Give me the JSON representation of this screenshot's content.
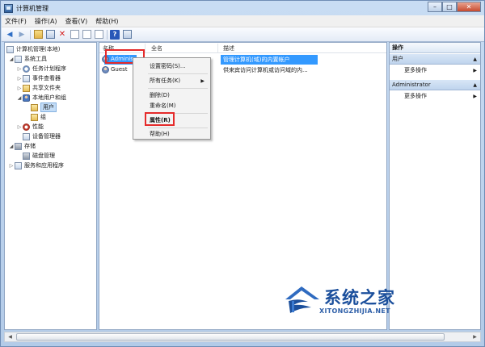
{
  "window": {
    "title": "计算机管理",
    "controls": {
      "minimize": "–",
      "maximize": "□",
      "close": "✕"
    }
  },
  "menu": [
    "文件(F)",
    "操作(A)",
    "查看(V)",
    "帮助(H)"
  ],
  "tree": {
    "root": "计算机管理(本地)",
    "system_tools": "系统工具",
    "task_scheduler": "任务计划程序",
    "event_viewer": "事件查看器",
    "shared_folders": "共享文件夹",
    "local_users_groups": "本地用户和组",
    "users": "用户",
    "groups": "组",
    "performance": "性能",
    "device_manager": "设备管理器",
    "storage": "存储",
    "disk_management": "磁盘管理",
    "services_apps": "服务和应用程序"
  },
  "list": {
    "headers": {
      "name": "名称",
      "fullname": "全名",
      "desc": "描述"
    },
    "rows": [
      {
        "name": "Adminis",
        "fullname": "",
        "desc": "管理计算机(域)的内置帐户"
      },
      {
        "name": "Guest",
        "fullname": "",
        "desc": "供来宾访问计算机或访问域的内..."
      }
    ]
  },
  "context_menu": {
    "set_password": "设置密码(S)...",
    "all_tasks": "所有任务(K)",
    "delete": "删除(D)",
    "rename": "重命名(M)",
    "properties": "属性(R)",
    "help": "帮助(H)"
  },
  "actions": {
    "header": "操作",
    "section1": "用户",
    "more1": "更多操作",
    "section2": "Administrator",
    "more2": "更多操作"
  },
  "watermark": {
    "text": "系统之家",
    "url": "XITONGZHIJIA.NET"
  },
  "colors": {
    "selection": "#3399ff",
    "highlight_box": "#e52a2a",
    "watermark": "#1b4f9c"
  }
}
